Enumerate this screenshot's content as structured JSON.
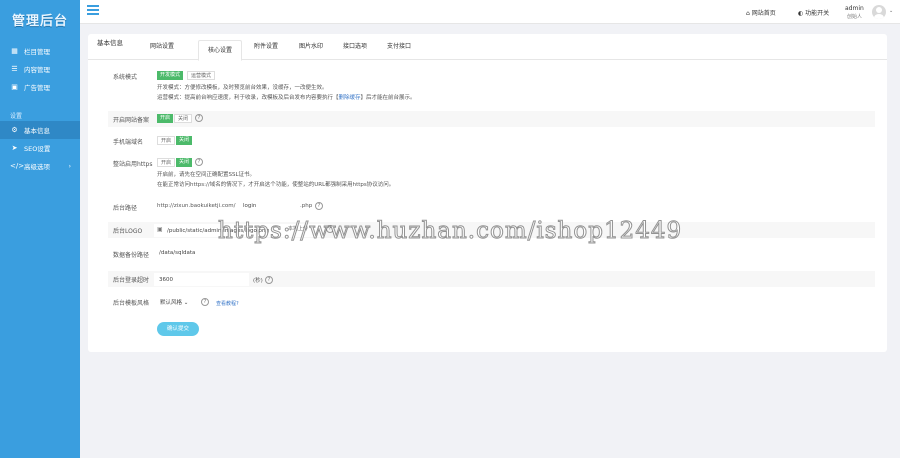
{
  "sidebar": {
    "logo": "管理后台",
    "items": [
      {
        "label": "栏目管理",
        "icon": "sitemap-icon"
      },
      {
        "label": "内容管理",
        "icon": "list-icon"
      },
      {
        "label": "广告管理",
        "icon": "image-icon"
      }
    ],
    "section": "设置",
    "settings": [
      {
        "label": "基本信息",
        "icon": "gear-icon"
      },
      {
        "label": "SEO设置",
        "icon": "send-icon"
      },
      {
        "label": "高级选项",
        "icon": "code-icon"
      }
    ]
  },
  "topbar": {
    "home": "网站首页",
    "toggle": "功能开关",
    "admin_name": "admin",
    "admin_role": "创始人"
  },
  "tabs": [
    "基本信息",
    "网站设置",
    "核心设置",
    "附件设置",
    "图片水印",
    "接口选项",
    "支付接口"
  ],
  "active_tab": "核心设置",
  "form": {
    "mode": {
      "label": "系统模式",
      "opt_dev": "开发模式",
      "opt_run": "运营模式",
      "help1": "开发模式：方便修改模板，及时预览前台效果，没缓存，一改便生效。",
      "help2a": "运营模式：提高前台响应速度，利于收录，改模板及后台发布内容要执行【",
      "help2link": "删除缓存",
      "help2b": "】后才能在前台展示。"
    },
    "icp": {
      "label": "开启网站备案",
      "on": "开启",
      "off": "关闭"
    },
    "mobile": {
      "label": "手机端域名",
      "on": "开启",
      "off": "关闭"
    },
    "https": {
      "label": "整站启用https",
      "on": "开启",
      "off": "关闭",
      "help1": "开启前，请先在空间正确配置SSL证书。",
      "help2": "在能正常访问https://域名的情况下，才开启这个功能，使整站的URL都强制采用https协议访问。"
    },
    "admin_path": {
      "label": "后台路径",
      "prefix": "http://zixun.baokuiketji.com/",
      "value": "login",
      "suffix": ".php"
    },
    "admin_logo": {
      "label": "后台LOGO",
      "value": "/public/static/admin/images/logo.png",
      "upload": "本地上传"
    },
    "backup": {
      "label": "数据备份路径",
      "value": "/data/sqldata"
    },
    "timeout": {
      "label": "后台登录超时",
      "value": "3600",
      "unit": "(秒)"
    },
    "theme": {
      "label": "后台模板风格",
      "selected": "默认风格",
      "link": "查看教程?"
    },
    "submit": "确认提交"
  },
  "watermark": "https://www.huzhan.com/ishop12449",
  "colors": {
    "sidebar": "#3a9edf",
    "active_green": "#4cba6a",
    "submit": "#5fc8ea"
  }
}
